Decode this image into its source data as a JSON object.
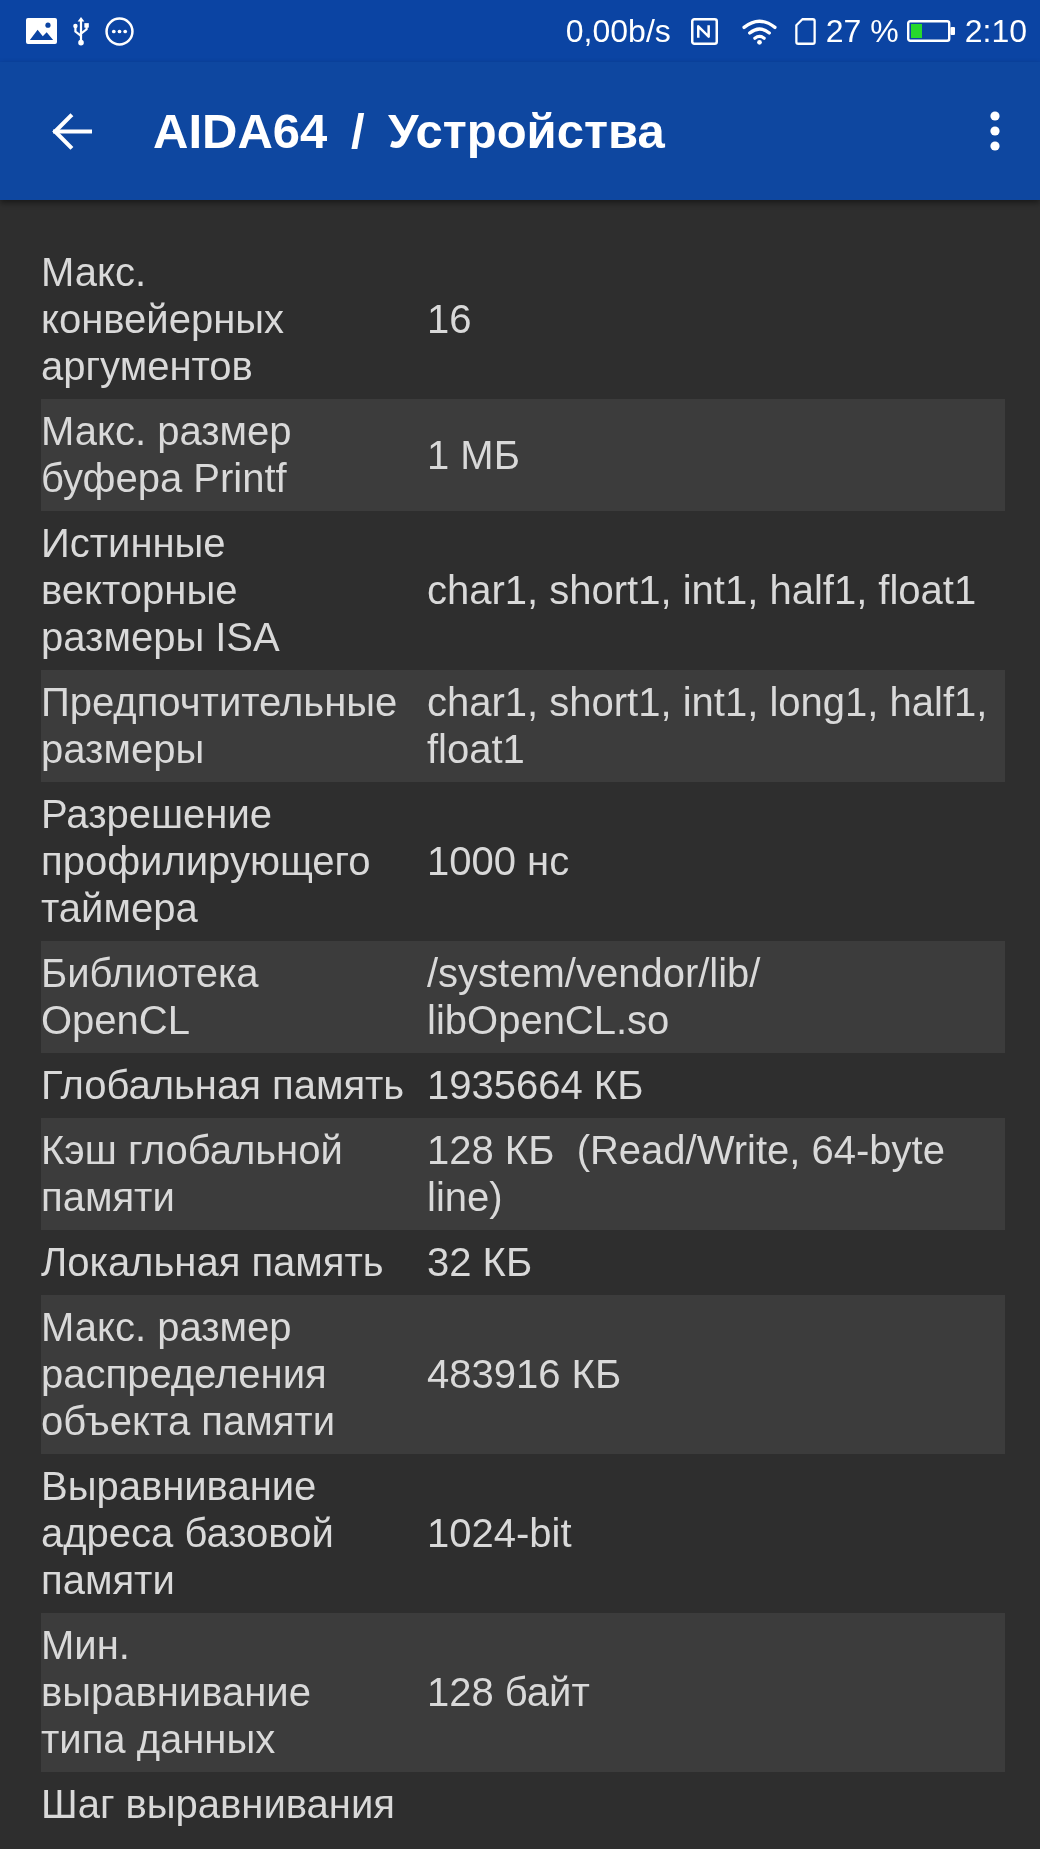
{
  "status_bar": {
    "network_speed": "0,00b/s",
    "battery": "27 %",
    "time": "2:10"
  },
  "app_bar": {
    "title": "AIDA64 / Устройства"
  },
  "rows": [
    {
      "label": "Макс.\nконвейерных\nаргументов",
      "value": "16"
    },
    {
      "label": "Макс. размер\nбуфера Printf",
      "value": "1 МБ"
    },
    {
      "label": "Истинные\nвекторные\nразмеры ISA",
      "value": "char1, short1, int1, half1, float1"
    },
    {
      "label": "Предпочтительные\nразмеры",
      "value": "char1, short1, int1, long1, half1,\nfloat1"
    },
    {
      "label": "Разрешение\nпрофилирующего\nтаймера",
      "value": "1000 нс"
    },
    {
      "label": "Библиотека\nOpenCL",
      "value": "/system/vendor/lib/\nlibOpenCL.so"
    },
    {
      "label": "Глобальная память",
      "value": "1935664 КБ"
    },
    {
      "label": "Кэш глобальной\nпамяти",
      "value": "128 КБ  (Read/Write, 64-byte\nline)"
    },
    {
      "label": "Локальная память",
      "value": "32 КБ"
    },
    {
      "label": "Макс. размер\nраспределения\nобъекта памяти",
      "value": "483916 КБ"
    },
    {
      "label": "Выравнивание\nадреса базовой\nпамяти",
      "value": "1024-bit"
    },
    {
      "label": "Мин.\nвыравнивание\nтипа данных",
      "value": "128 байт"
    },
    {
      "label": "Шаг выравнивания"
    }
  ]
}
